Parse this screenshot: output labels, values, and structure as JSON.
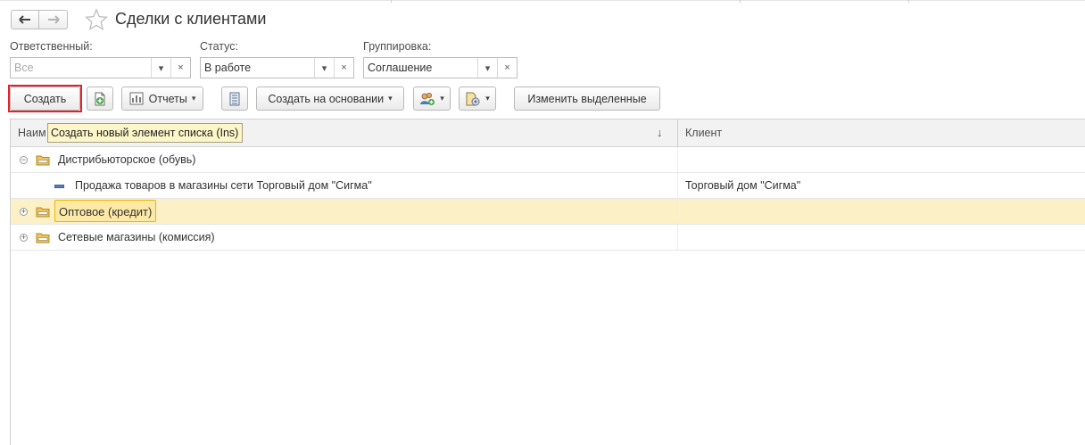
{
  "window": {
    "title": "Сделки с клиентами"
  },
  "filters": {
    "responsible": {
      "label": "Ответственный:",
      "value": "",
      "placeholder": "Все"
    },
    "status": {
      "label": "Статус:",
      "value": "В работе"
    },
    "grouping": {
      "label": "Группировка:",
      "value": "Соглашение"
    },
    "dropdown_glyph": "▾",
    "clear_glyph": "×"
  },
  "toolbar": {
    "create_label": "Создать",
    "reports_label": "Отчеты",
    "create_based_label": "Создать на основании",
    "change_selected_label": "Изменить выделенные",
    "dropdown_glyph": "▾"
  },
  "tooltip": {
    "text": "Создать новый элемент списка (Ins)"
  },
  "table": {
    "columns": {
      "name": "Наим",
      "client": "Клиент"
    },
    "sort_glyph": "↓",
    "rows": [
      {
        "type": "group",
        "expanded": true,
        "label": "Дистрибьюторское (обувь)",
        "client": ""
      },
      {
        "type": "item",
        "label": "Продажа товаров в магазины сети Торговый дом \"Сигма\"",
        "client": "Торговый дом \"Сигма\""
      },
      {
        "type": "group",
        "expanded": false,
        "selected": true,
        "label": "Оптовое (кредит)",
        "client": ""
      },
      {
        "type": "group",
        "expanded": false,
        "label": "Сетевые магазины (комиссия)",
        "client": ""
      }
    ]
  },
  "colors": {
    "accent_highlight": "#e3222b",
    "selection": "#fcf0c6",
    "tooltip_bg": "#fdf6c8"
  }
}
